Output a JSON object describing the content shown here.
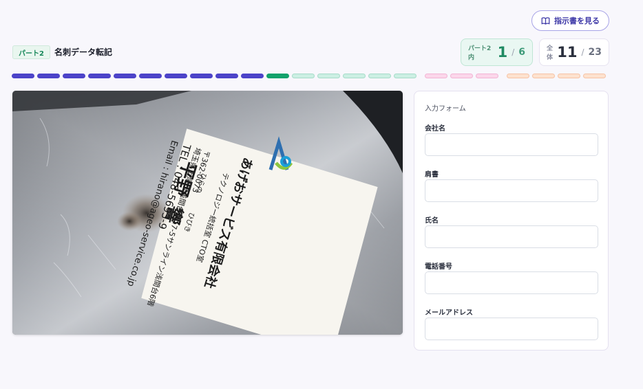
{
  "header": {
    "instructions_button": "指示書を見る",
    "part_badge": "パート2",
    "task_title": "名刺データ転記",
    "part_counter": {
      "label": "パート2内",
      "current": "1",
      "slash": "/",
      "total": "6"
    },
    "overall_counter": {
      "label": "全体",
      "current": "11",
      "slash": "/",
      "total": "23"
    }
  },
  "progress": {
    "completed": 10,
    "current_index": 11,
    "part2_remaining": 5,
    "part3_count": 3,
    "part4_count": 4
  },
  "business_card": {
    "company": "あげおサービス有限会社",
    "department": "テクノロジー統括室 CTO室",
    "family_name_reading": "ひらの",
    "given_name_reading": "ひびき",
    "family_name": "平野",
    "given_name": "響",
    "postal": "〒362-0073",
    "address": "埼玉県上尾市浅間台2-17-5サンライン浅間台6階",
    "tel": "TEL : 048-5693-9",
    "email": "Email : hirano@ageo-service.co.jp"
  },
  "form": {
    "title": "入力フォーム",
    "fields": [
      {
        "label": "会社名",
        "value": ""
      },
      {
        "label": "肩書",
        "value": ""
      },
      {
        "label": "氏名",
        "value": ""
      },
      {
        "label": "電話番号",
        "value": ""
      },
      {
        "label": "メールアドレス",
        "value": ""
      }
    ]
  },
  "colors": {
    "accent": "#4c43c9",
    "current": "#12a26b",
    "part2": "#ccefe3",
    "part3": "#fbd7ea",
    "part4": "#fde2cf"
  }
}
